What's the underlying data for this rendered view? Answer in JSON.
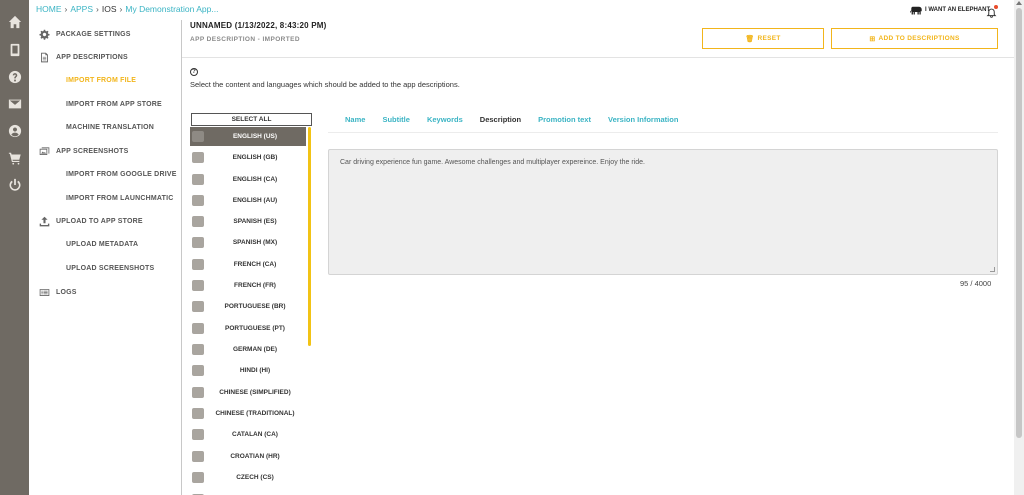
{
  "breadcrumb": {
    "home": "HOME",
    "apps": "APPS",
    "platform": "IOS",
    "app": "My Demonstration App..."
  },
  "brand": {
    "name": "I WANT AN ELEPHANT"
  },
  "sidebar": {
    "items": [
      {
        "label": "PACKAGE SETTINGS",
        "icon": "gear-icon"
      },
      {
        "label": "APP DESCRIPTIONS",
        "icon": "document-icon"
      },
      {
        "label": "IMPORT FROM FILE",
        "active": true
      },
      {
        "label": "IMPORT FROM APP STORE"
      },
      {
        "label": "MACHINE TRANSLATION"
      },
      {
        "label": "APP SCREENSHOTS",
        "icon": "images-icon"
      },
      {
        "label": "IMPORT FROM GOOGLE DRIVE"
      },
      {
        "label": "IMPORT FROM LAUNCHMATIC"
      },
      {
        "label": "UPLOAD TO APP STORE",
        "icon": "upload-icon"
      },
      {
        "label": "UPLOAD METADATA"
      },
      {
        "label": "UPLOAD SCREENSHOTS"
      },
      {
        "label": "LOGS",
        "icon": "logs-icon"
      }
    ]
  },
  "header": {
    "title": "UNNAMED (1/13/2022, 8:43:20 PM)",
    "subtitle": "APP DESCRIPTION - IMPORTED",
    "reset_label": "RESET",
    "add_label": "ADD TO DESCRIPTIONS"
  },
  "help": {
    "icon": "?",
    "text": "Select the content and languages which should be added to the app descriptions."
  },
  "languages": {
    "select_all": "SELECT ALL",
    "items": [
      "ENGLISH (US)",
      "ENGLISH (GB)",
      "ENGLISH (CA)",
      "ENGLISH (AU)",
      "SPANISH (ES)",
      "SPANISH (MX)",
      "FRENCH (CA)",
      "FRENCH (FR)",
      "PORTUGUESE (BR)",
      "PORTUGUESE (PT)",
      "GERMAN (DE)",
      "HINDI (HI)",
      "CHINESE (SIMPLIFIED)",
      "CHINESE (TRADITIONAL)",
      "CATALAN (CA)",
      "CROATIAN (HR)",
      "CZECH (CS)"
    ],
    "selected": "ENGLISH (US)"
  },
  "tabs": {
    "items": [
      "Name",
      "Subtitle",
      "Keywords",
      "Description",
      "Promotion text",
      "Version Information"
    ],
    "active": "Description"
  },
  "content": {
    "description": "Car driving experience fun game. Awesome challenges and multiplayer expereince. Enjoy the ride.",
    "counter": "95 / 4000"
  },
  "colors": {
    "accent": "#f2b51b",
    "link": "#3bb4c4",
    "rail": "#6f6a63"
  }
}
